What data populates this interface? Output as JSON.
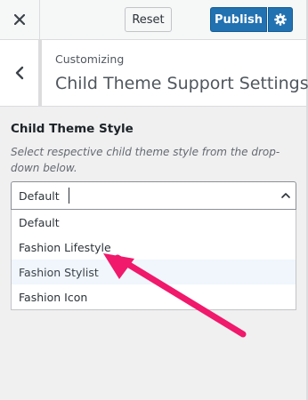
{
  "header": {
    "close_icon": "close-icon",
    "reset_label": "Reset",
    "publish_label": "Publish",
    "settings_icon": "gear-icon"
  },
  "section": {
    "breadcrumb": "Customizing",
    "title": "Child Theme Support Settings",
    "back_icon": "chevron-left-icon"
  },
  "control": {
    "title": "Child Theme Style",
    "description": "Select respective child theme style from the drop-down below.",
    "selected": "Default",
    "options": [
      "Default",
      "Fashion Lifestyle",
      "Fashion Stylist",
      "Fashion Icon"
    ]
  },
  "colors": {
    "accent": "#2271b1",
    "annotation_arrow": "#f0196b"
  }
}
